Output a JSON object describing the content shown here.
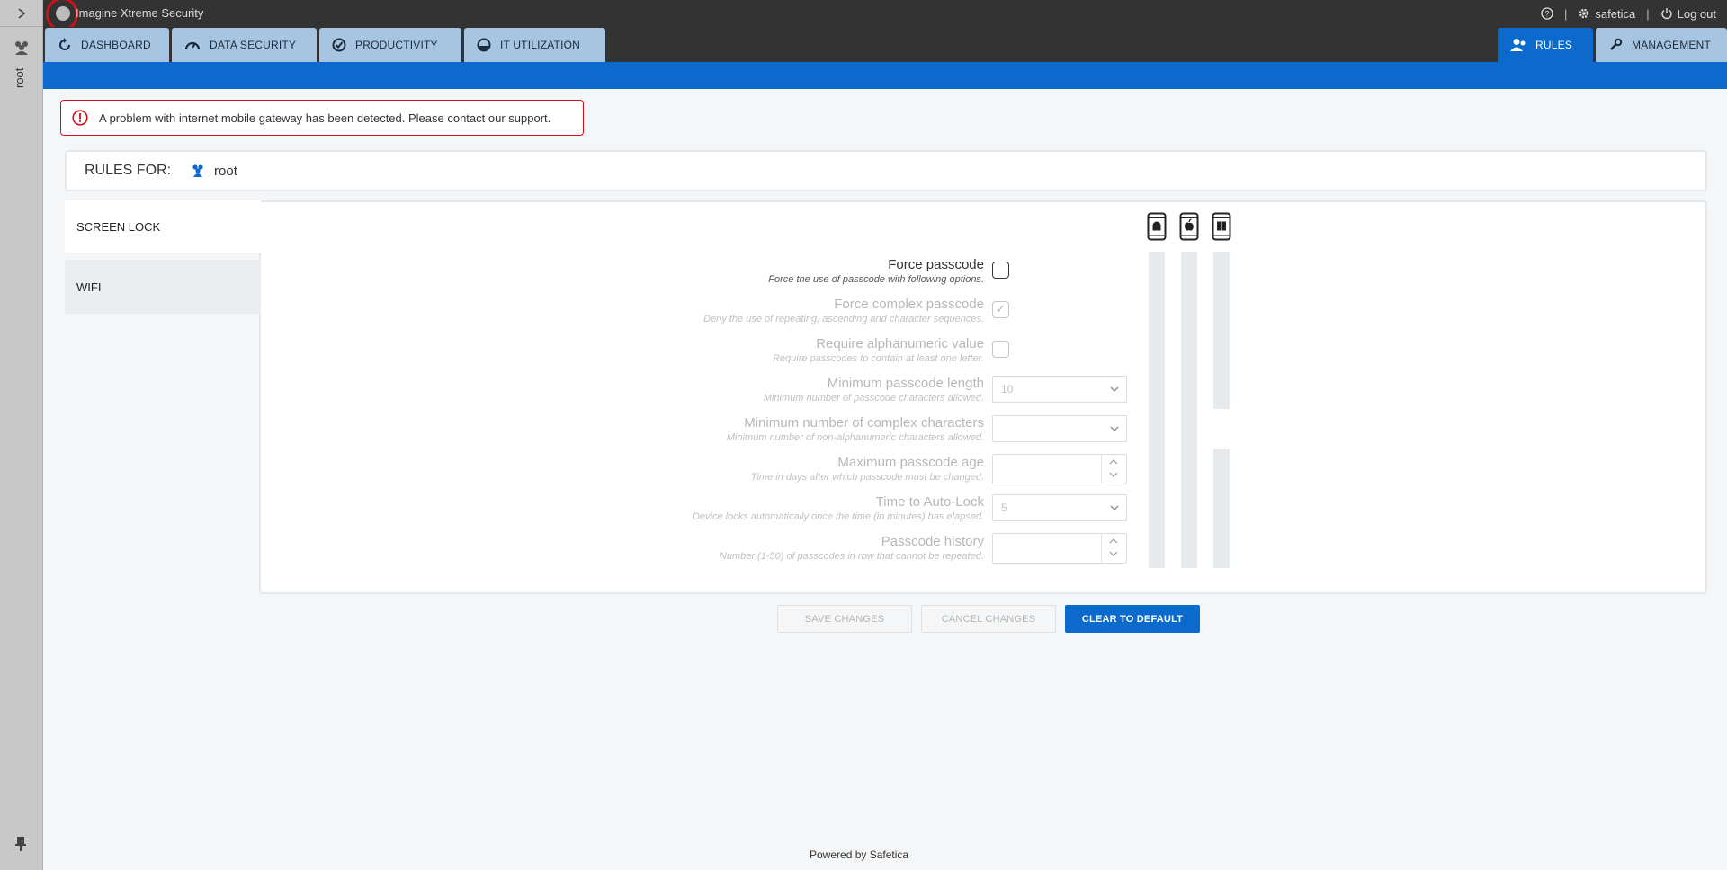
{
  "window": {
    "app_title": "Imagine Xtreme Security"
  },
  "left_rail": {
    "user_label": "root"
  },
  "top_right": {
    "help_symbol": "?",
    "separator": "|",
    "user_name": "safetica",
    "logout_label": "Log out"
  },
  "tabs": [
    {
      "label": "DASHBOARD",
      "icon": "refresh-icon"
    },
    {
      "label": "DATA SECURITY",
      "icon": "gauge-icon"
    },
    {
      "label": "PRODUCTIVITY",
      "icon": "check-circle-icon"
    },
    {
      "label": "IT UTILIZATION",
      "icon": "half-circle-icon"
    }
  ],
  "right_tabs": [
    {
      "label": "RULES",
      "icon": "user-settings-icon",
      "active": true
    },
    {
      "label": "MANAGEMENT",
      "icon": "wrench-icon",
      "active": false
    }
  ],
  "alert": {
    "text": "A problem with internet mobile gateway has been detected. Please contact our support."
  },
  "rules_for": {
    "label": "RULES FOR:",
    "value": "root"
  },
  "side_tabs": [
    {
      "label": "SCREEN LOCK"
    },
    {
      "label": "WIFI"
    }
  ],
  "devices": [
    "android-phone-icon",
    "apple-phone-icon",
    "windows-phone-icon"
  ],
  "settings": [
    {
      "label": "Force passcode",
      "desc": "Force the use of passcode with following options.",
      "control": "checkbox",
      "checked": false,
      "enabled": true
    },
    {
      "label": "Force complex passcode",
      "desc": "Deny the use of repeating, ascending and character sequences.",
      "control": "checkbox",
      "checked": true,
      "enabled": false
    },
    {
      "label": "Require alphanumeric value",
      "desc": "Require passcodes to contain at least one letter.",
      "control": "checkbox",
      "checked": false,
      "enabled": false
    },
    {
      "label": "Minimum passcode length",
      "desc": "Minimum number of passcode characters allowed.",
      "control": "select",
      "value": "10",
      "enabled": false
    },
    {
      "label": "Minimum number of complex characters",
      "desc": "Minimum number of non-alphanumeric characters allowed.",
      "control": "select",
      "value": "",
      "enabled": false
    },
    {
      "label": "Maximum passcode age",
      "desc": "Time in days after which passcode must be changed.",
      "control": "spinner",
      "value": "",
      "enabled": false
    },
    {
      "label": "Time to Auto-Lock",
      "desc": "Device locks automatically once the time (in minutes) has elapsed.",
      "control": "select",
      "value": "5",
      "enabled": false
    },
    {
      "label": "Passcode history",
      "desc": "Number (1-50) of passcodes in row that cannot be repeated.",
      "control": "spinner",
      "value": "",
      "enabled": false
    }
  ],
  "buttons": {
    "save": "SAVE CHANGES",
    "cancel": "CANCEL CHANGES",
    "clear": "CLEAR TO DEFAULT"
  },
  "footer": {
    "text": "Powered by Safetica"
  },
  "colors": {
    "accent": "#0b6acb",
    "tab_inactive": "#a7c4e0",
    "topbar": "#333333",
    "alert_border": "#d0101a"
  }
}
